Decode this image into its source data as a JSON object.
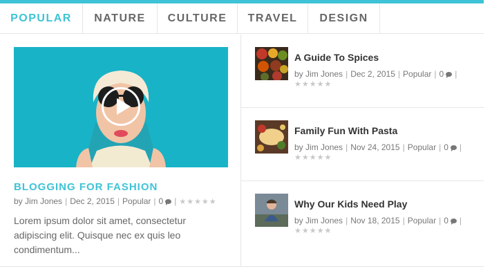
{
  "tabs": [
    {
      "label": "POPULAR",
      "active": true
    },
    {
      "label": "NATURE",
      "active": false
    },
    {
      "label": "CULTURE",
      "active": false
    },
    {
      "label": "TRAVEL",
      "active": false
    },
    {
      "label": "DESIGN",
      "active": false
    }
  ],
  "featured": {
    "title": "BLOGGING FOR FASHION",
    "meta": {
      "by": "by",
      "author": "Jim Jones",
      "date": "Dec 2, 2015",
      "category": "Popular",
      "comments": "0"
    },
    "rating": 0,
    "excerpt": "Lorem ipsum dolor sit amet, consectetur adipiscing elit. Quisque nec ex quis leo condimentum..."
  },
  "posts": [
    {
      "title": "A Guide To Spices",
      "by": "by",
      "author": "Jim Jones",
      "date": "Dec 2, 2015",
      "category": "Popular",
      "comments": "0",
      "rating": 0
    },
    {
      "title": "Family Fun With Pasta",
      "by": "by",
      "author": "Jim Jones",
      "date": "Nov 24, 2015",
      "category": "Popular",
      "comments": "0",
      "rating": 0
    },
    {
      "title": "Why Our Kids Need Play",
      "by": "by",
      "author": "Jim Jones",
      "date": "Nov 18, 2015",
      "category": "Popular",
      "comments": "0",
      "rating": 0
    }
  ],
  "colors": {
    "accent": "#3ec3d6",
    "hero_bg": "#18b3c6",
    "star_empty": "#c8c8c8"
  },
  "icons": {
    "play": "play-icon",
    "comment": "comment-icon",
    "star": "star-icon"
  }
}
